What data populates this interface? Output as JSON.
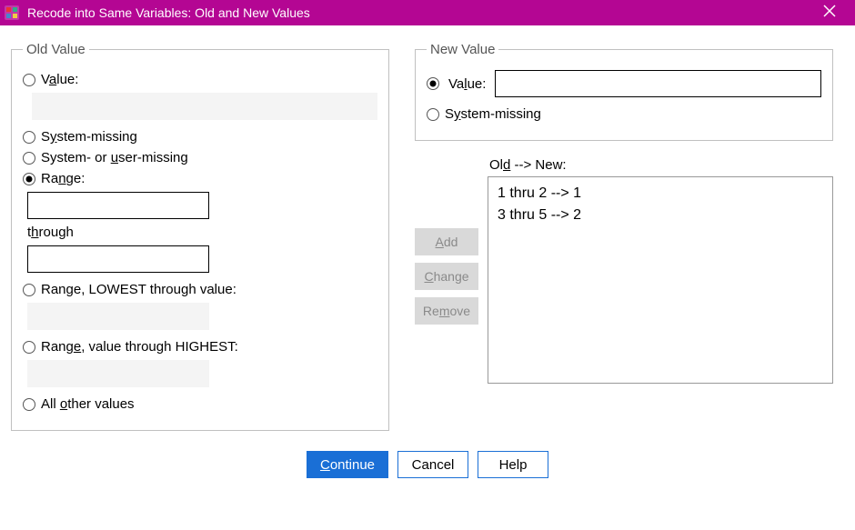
{
  "titlebar": {
    "title": "Recode into Same Variables: Old and New Values"
  },
  "old_value": {
    "legend": "Old Value",
    "value_label_pre": "V",
    "value_label_ul": "a",
    "value_label_post": "lue:",
    "system_missing_pre": "S",
    "system_missing_ul": "y",
    "system_missing_post": "stem-missing",
    "system_user_missing_pre": "System- or ",
    "system_user_missing_ul": "u",
    "system_user_missing_post": "ser-missing",
    "range_pre": "Ra",
    "range_ul": "n",
    "range_post": "ge:",
    "through_pre": "t",
    "through_ul": "h",
    "through_post": "rough",
    "range_lowest_pre": "Ran",
    "range_lowest_ul": "g",
    "range_lowest_post": "e, LOWEST through value:",
    "range_highest_pre": "Rang",
    "range_highest_ul": "e",
    "range_highest_post": ", value through HIGHEST:",
    "all_other_pre": "All ",
    "all_other_ul": "o",
    "all_other_post": "ther values"
  },
  "new_value": {
    "legend": "New Value",
    "value_pre": "Va",
    "value_ul": "l",
    "value_post": "ue:",
    "system_missing_pre": "S",
    "system_missing_ul": "y",
    "system_missing_post": "stem-missing"
  },
  "mapping": {
    "label_pre": "Ol",
    "label_ul": "d",
    "label_post": " --> New:",
    "rules": [
      "1 thru 2 --> 1",
      "3 thru 5 --> 2"
    ],
    "add_ul": "A",
    "add_post": "dd",
    "change_ul": "C",
    "change_post": "hange",
    "remove_pre": "Re",
    "remove_ul": "m",
    "remove_post": "ove"
  },
  "buttons": {
    "continue_ul": "C",
    "continue_post": "ontinue",
    "cancel": "Cancel",
    "help": "Help"
  }
}
